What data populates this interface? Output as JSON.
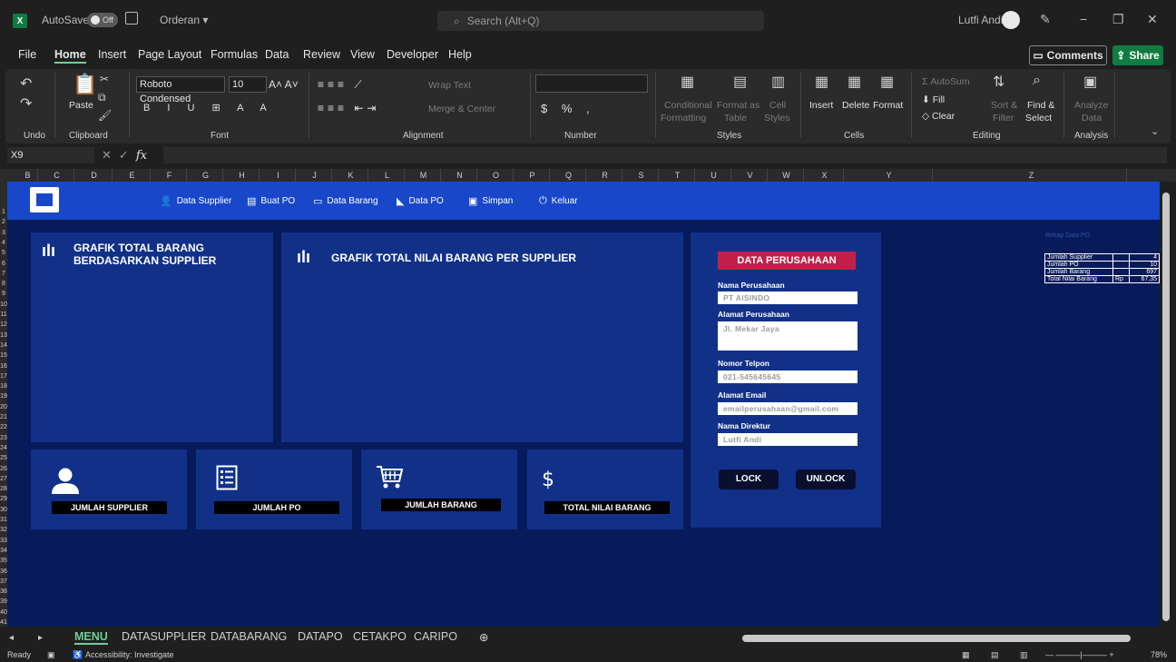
{
  "titlebar": {
    "autosave_label": "AutoSave",
    "autosave_state": "Off",
    "doc_name": "Orderan ▾",
    "search_placeholder": "Search (Alt+Q)",
    "user_name": "Lutfi Andi"
  },
  "menu": {
    "tabs": [
      "File",
      "Home",
      "Insert",
      "Page Layout",
      "Formulas",
      "Data",
      "Review",
      "View",
      "Developer",
      "Help"
    ],
    "active": "Home",
    "comments_label": "Comments",
    "share_label": "Share"
  },
  "ribbon": {
    "groups": [
      "Undo",
      "Clipboard",
      "Font",
      "Alignment",
      "Number",
      "Styles",
      "Cells",
      "Editing",
      "Analysis"
    ],
    "paste_label": "Paste",
    "font_name": "Roboto Condensed",
    "font_size": "10",
    "wrap_text": "Wrap Text",
    "merge_center": "Merge & Center",
    "conditional": "Conditional",
    "formatting": "Formatting",
    "format_as": "Format as",
    "table": "Table",
    "cell": "Cell",
    "styles": "Styles",
    "insert": "Insert",
    "delete": "Delete",
    "format": "Format",
    "autosum": "AutoSum",
    "fill": "Fill",
    "clear": "Clear",
    "sort_filter_1": "Sort &",
    "sort_filter_2": "Filter",
    "find_select_1": "Find &",
    "find_select_2": "Select",
    "analyze_1": "Analyze",
    "analyze_2": "Data"
  },
  "formula_bar": {
    "name_box": "X9"
  },
  "columns": [
    "B",
    "C",
    "D",
    "E",
    "F",
    "G",
    "H",
    "I",
    "J",
    "K",
    "L",
    "M",
    "N",
    "O",
    "P",
    "Q",
    "R",
    "S",
    "T",
    "U",
    "V",
    "W",
    "X",
    "Y",
    "Z"
  ],
  "rows": [
    "1",
    "2",
    "3",
    "4",
    "5",
    "6",
    "7",
    "8",
    "9",
    "10",
    "11",
    "12",
    "13",
    "14",
    "15",
    "16",
    "17",
    "18",
    "19",
    "20",
    "21",
    "22",
    "23",
    "24",
    "25",
    "26",
    "27",
    "28",
    "29",
    "30",
    "31",
    "32",
    "33",
    "34",
    "35",
    "36",
    "37",
    "38",
    "39",
    "40",
    "41"
  ],
  "nav": {
    "items": [
      "Data Supplier",
      "Buat PO",
      "Data Barang",
      "Data PO",
      "Simpan",
      "Keluar"
    ]
  },
  "panels": {
    "chart1_title": "GRAFIK TOTAL BARANG BERDASARKAN SUPPLIER",
    "chart2_title": "GRAFIK TOTAL NILAI BARANG PER SUPPLIER"
  },
  "stats": [
    "JUMLAH SUPPLIER",
    "JUMLAH PO",
    "JUMLAH BARANG",
    "TOTAL NILAI BARANG"
  ],
  "company": {
    "title": "DATA PERUSAHAAN",
    "name_label": "Nama Perusahaan",
    "name_value": "PT AISINDO",
    "address_label": "Alamat Perusahaan",
    "address_value": "Jl. Mekar Jaya",
    "phone_label": "Nomor Telpon",
    "phone_value": "021-545645645",
    "email_label": "Alamat Email",
    "email_value": "emailperusahaan@gmail.com",
    "director_label": "Nama Direktur",
    "director_value": "Lutfi Andi",
    "lock_label": "LOCK",
    "unlock_label": "UNLOCK"
  },
  "recap": {
    "title": "Rekap Data PO",
    "rows": [
      {
        "label": "Jumlah Supplier",
        "unit": "",
        "value": "4"
      },
      {
        "label": "Jumlah PO",
        "unit": "",
        "value": "10"
      },
      {
        "label": "Jumlah Barang",
        "unit": "",
        "value": "697"
      },
      {
        "label": "Total Nilai Barang",
        "unit": "Rp",
        "value": "67,35"
      }
    ]
  },
  "sheets": {
    "tabs": [
      "MENU",
      "DATASUPPLIER",
      "DATABARANG",
      "DATAPO",
      "CETAKPO",
      "CARIPO"
    ],
    "active": "MENU"
  },
  "status": {
    "ready": "Ready",
    "accessibility": "Accessibility: Investigate",
    "zoom": "78%"
  }
}
